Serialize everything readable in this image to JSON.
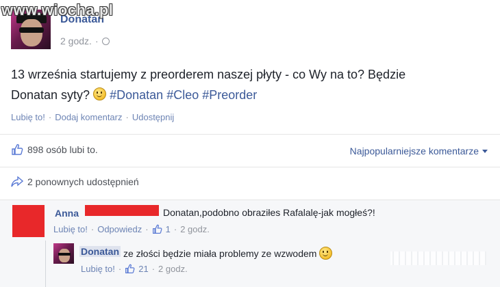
{
  "watermark": "www.wiocha.pl",
  "post": {
    "author": "Donatan",
    "time": "2 godz.",
    "separator": "·",
    "text_line1": "13 września startujemy z preorderem naszej płyty - co Wy na to? Będzie",
    "text_line2_start": "Donatan syty?",
    "hashtags": [
      "#Donatan",
      "#Cleo",
      "#Preorder"
    ],
    "actions": {
      "like": "Lubię to!",
      "comment": "Dodaj komentarz",
      "share": "Udostępnij"
    }
  },
  "likes": {
    "text": "898 osób lubi to.",
    "sort_label": "Najpopularniejsze komentarze"
  },
  "shares": {
    "text": "2 ponownych udostępnień"
  },
  "comments": [
    {
      "author": "Anna",
      "text": "Donatan,podobno obraziłes Rafalalę-jak mogłeś?!",
      "like": "Lubię to!",
      "reply": "Odpowiedz",
      "like_count": "1",
      "time": "2 godz."
    },
    {
      "author": "Donatan",
      "text": "ze złości będzie miała problemy ze wzwodem",
      "like": "Lubię to!",
      "like_count": "21",
      "time": "2 godz."
    }
  ],
  "colors": {
    "link": "#3b5998",
    "redaction": "#e8282a",
    "muted": "#90949c"
  },
  "icons": [
    "globe-icon",
    "thumbs-up-icon",
    "share-arrow-icon",
    "smiley-icon",
    "caret-down-icon"
  ]
}
